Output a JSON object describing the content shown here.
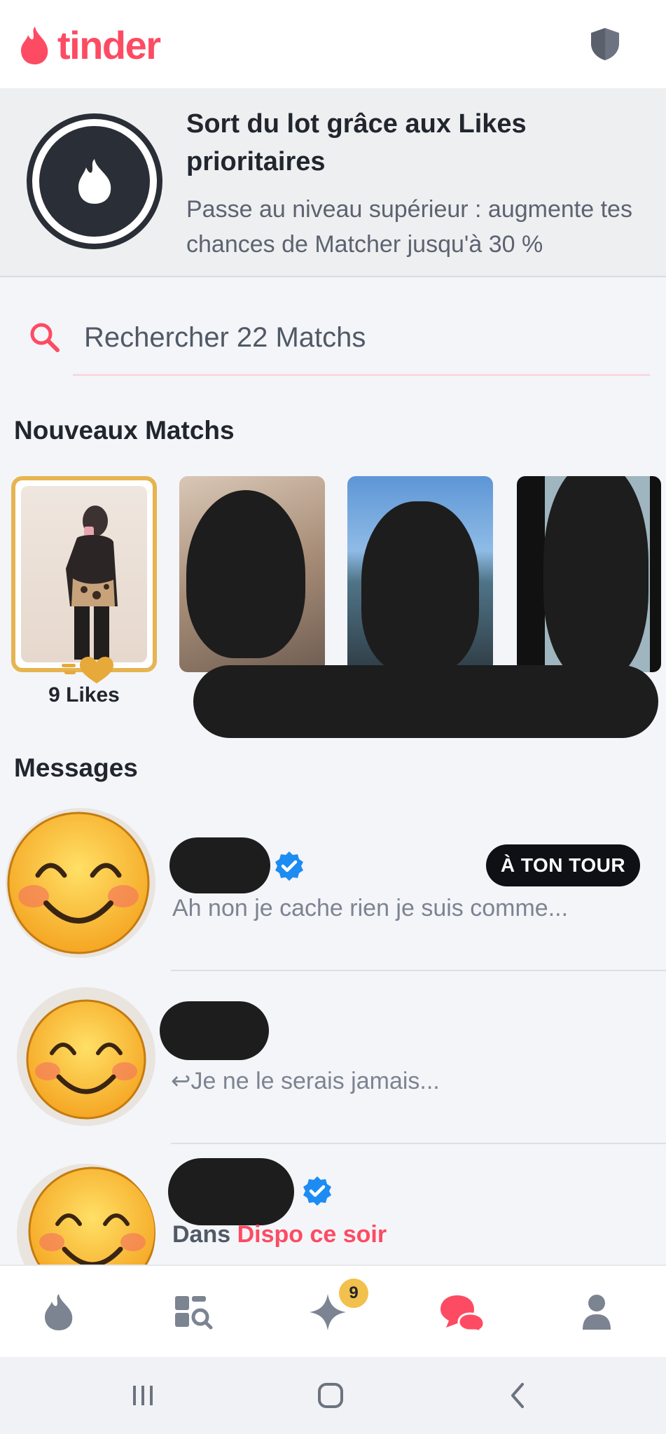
{
  "app": {
    "logo_text": "tinder",
    "brand_color": "#fd4b63"
  },
  "promo": {
    "title": "Sort du lot grâce aux Likes prioritaires",
    "subtitle": "Passe au niveau supérieur : augmente tes chances de Matcher jusqu'à 30 %"
  },
  "search": {
    "placeholder": "Rechercher 22 Matchs"
  },
  "new_matches": {
    "title": "Nouveaux Matchs",
    "likes_label": "9 Likes"
  },
  "messages": {
    "title": "Messages",
    "items": [
      {
        "preview": "Ah non je cache rien je suis comme...",
        "badge": "À TON TOUR",
        "verified": true
      },
      {
        "preview": "↩Je ne le serais jamais...",
        "verified": false
      },
      {
        "preview_prefix": "Dans ",
        "preview_highlight": "Dispo ce soir",
        "verified": true
      }
    ]
  },
  "navbar": {
    "items": [
      "flame-icon",
      "explore-icon",
      "sparkle-icon",
      "messages-icon",
      "profile-icon"
    ],
    "active": "messages-icon",
    "badge": "9"
  },
  "system_nav": [
    "recent-apps-icon",
    "home-icon",
    "back-icon"
  ]
}
